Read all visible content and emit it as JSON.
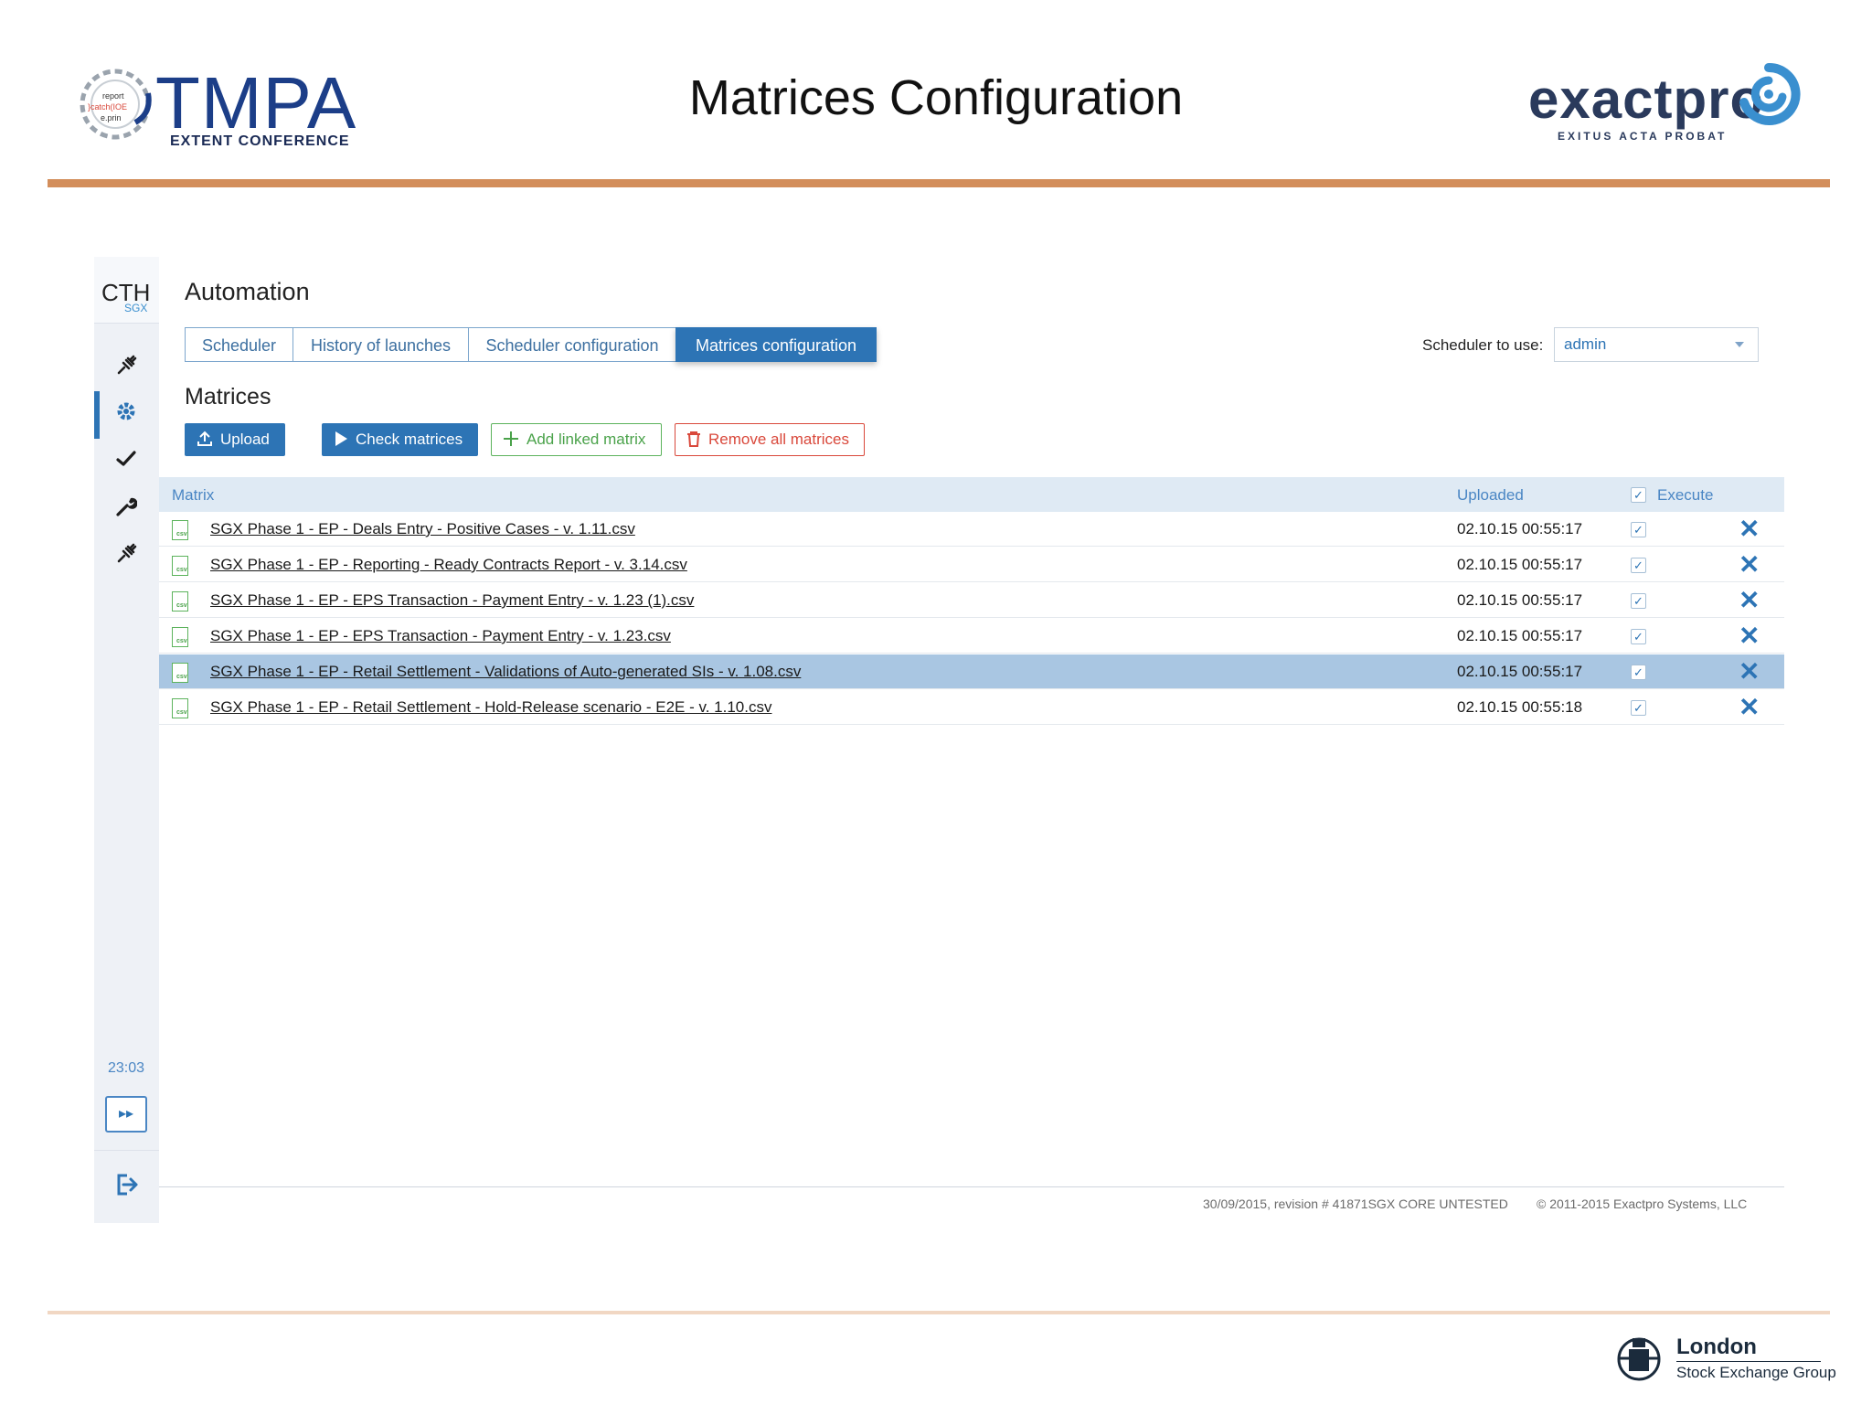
{
  "slide": {
    "title": "Matrices Configuration",
    "tmpa_logo": {
      "name": "TMPA",
      "subtitle": "EXTENT CONFERENCE",
      "gear_text": [
        "report",
        "}catch(IOE",
        "e.prin"
      ]
    },
    "exactpro_logo": {
      "name": "exactpro",
      "tagline": "EXITUS ACTA PROBAT",
      "accent": "#3a8fcf"
    },
    "lse_logo": {
      "name": "London",
      "group": "Stock Exchange Group"
    },
    "rule_color": "#d38e5b"
  },
  "app": {
    "brand": "CTH",
    "brand_sub": "SGX",
    "title": "Automation",
    "accent": "#2d74b5",
    "sidebar": {
      "icons": [
        "plug-icon",
        "gear-icon",
        "check-icon",
        "wrench-icon",
        "plug-icon"
      ],
      "active_index": 1,
      "time": "23:03",
      "play_icon": "fast-forward-icon",
      "logout_icon": "logout-icon"
    },
    "tabs": [
      {
        "label": "Scheduler",
        "active": false
      },
      {
        "label": "History of launches",
        "active": false
      },
      {
        "label": "Scheduler configuration",
        "active": false
      },
      {
        "label": "Matrices configuration",
        "active": true
      }
    ],
    "scheduler": {
      "label": "Scheduler to use:",
      "value": "admin"
    },
    "section_title": "Matrices",
    "buttons": {
      "upload": "Upload",
      "check": "Check matrices",
      "add": "Add linked matrix",
      "remove": "Remove all matrices"
    },
    "table": {
      "headers": {
        "matrix": "Matrix",
        "uploaded": "Uploaded",
        "execute": "Execute"
      },
      "file_badge": "csv",
      "rows": [
        {
          "name": "SGX Phase 1 - EP - Deals Entry - Positive Cases - v. 1.11.csv",
          "uploaded": "02.10.15 00:55:17",
          "execute": true,
          "selected": false
        },
        {
          "name": "SGX Phase 1 - EP - Reporting - Ready Contracts Report - v. 3.14.csv",
          "uploaded": "02.10.15 00:55:17",
          "execute": true,
          "selected": false
        },
        {
          "name": "SGX Phase 1 - EP - EPS Transaction - Payment Entry - v. 1.23 (1).csv",
          "uploaded": "02.10.15 00:55:17",
          "execute": true,
          "selected": false
        },
        {
          "name": "SGX Phase 1 - EP - EPS Transaction - Payment Entry - v. 1.23.csv",
          "uploaded": "02.10.15 00:55:17",
          "execute": true,
          "selected": false
        },
        {
          "name": "SGX Phase 1 - EP - Retail Settlement - Validations of Auto-generated SIs - v. 1.08.csv",
          "uploaded": "02.10.15 00:55:17",
          "execute": true,
          "selected": true
        },
        {
          "name": "SGX Phase 1 - EP - Retail Settlement - Hold-Release scenario - E2E - v. 1.10.csv",
          "uploaded": "02.10.15 00:55:18",
          "execute": true,
          "selected": false
        }
      ]
    },
    "footer": {
      "revision": "30/09/2015, revision # 41871SGX CORE UNTESTED",
      "copyright": "© 2011-2015 Exactpro Systems, LLC"
    }
  }
}
